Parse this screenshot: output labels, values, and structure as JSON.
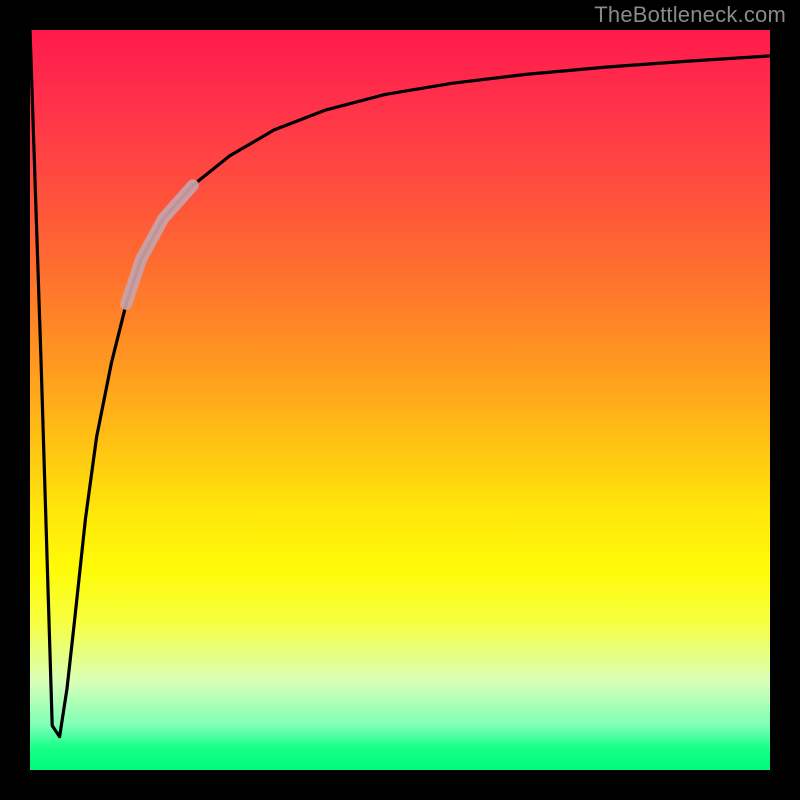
{
  "attribution": "TheBottleneck.com",
  "chart_data": {
    "type": "line",
    "title": "",
    "xlabel": "",
    "ylabel": "",
    "xlim": [
      0,
      100
    ],
    "ylim": [
      0,
      100
    ],
    "series": [
      {
        "name": "bottleneck-curve",
        "x": [
          0,
          1.5,
          3,
          4,
          5,
          6,
          7.5,
          9,
          11,
          13,
          15,
          18,
          22,
          27,
          33,
          40,
          48,
          57,
          67,
          78,
          89,
          100
        ],
        "y": [
          100,
          55,
          6,
          4.5,
          11,
          20,
          34,
          45,
          55,
          63,
          69,
          74.5,
          79,
          83,
          86.5,
          89.2,
          91.3,
          92.8,
          94,
          95,
          95.8,
          96.5
        ]
      },
      {
        "name": "highlight-segment",
        "x": [
          13,
          15,
          18,
          22
        ],
        "y": [
          63,
          69,
          74.5,
          79
        ]
      }
    ],
    "gradient_stops": [
      {
        "pos": 0,
        "color": "#ff1a4d"
      },
      {
        "pos": 20,
        "color": "#ff4a3f"
      },
      {
        "pos": 45,
        "color": "#ff9820"
      },
      {
        "pos": 65,
        "color": "#ffe70a"
      },
      {
        "pos": 88,
        "color": "#d8ffb8"
      },
      {
        "pos": 100,
        "color": "#00f97b"
      }
    ]
  }
}
